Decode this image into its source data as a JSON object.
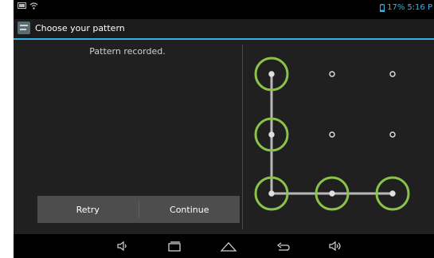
{
  "status_bar": {
    "battery": "17%",
    "time": "5:16 P"
  },
  "action_bar": {
    "title": "Choose your pattern"
  },
  "main": {
    "message": "Pattern recorded.",
    "buttons": {
      "retry": "Retry",
      "continue": "Continue"
    }
  },
  "pattern": {
    "selected_dots": [
      1,
      4,
      7,
      8,
      9
    ],
    "path_order": [
      1,
      4,
      7,
      8,
      9
    ],
    "accent_color": "#8bc34a",
    "line_color": "#b8b8b8"
  },
  "nav_bar": {
    "buttons": [
      "volume-down",
      "recent-apps",
      "home",
      "back",
      "volume-up"
    ]
  },
  "colors": {
    "accent": "#33b5e5",
    "background": "#202020"
  }
}
